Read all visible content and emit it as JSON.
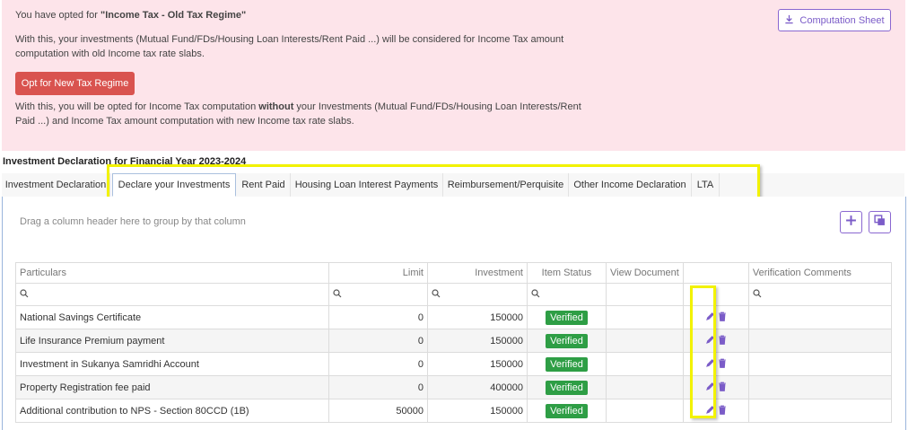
{
  "banner": {
    "line1_prefix": "You have opted for ",
    "line1_bold": "\"Income Tax - Old Tax Regime\"",
    "line2": "With this, your investments (Mutual Fund/FDs/Housing Loan Interests/Rent Paid ...) will be considered for Income Tax amount",
    "line3": "computation with old Income tax rate slabs.",
    "opt_button": "Opt for New Tax Regime",
    "line4_prefix": "With this, you will be opted for Income Tax computation ",
    "line4_bold": "without",
    "line4_suffix": " your Investments (Mutual Fund/FDs/Housing Loan Interests/Rent",
    "line5": "Paid ...) and Income Tax amount computation with new Income tax rate slabs.",
    "computation_button": "Computation Sheet"
  },
  "section_title": "Investment Declaration for Financial Year 2023-2024",
  "tabs": [
    "Investment Declaration",
    "Declare your Investments",
    "Rent Paid",
    "Housing Loan Interest Payments",
    "Reimbursement/Perquisite",
    "Other Income Declaration",
    "LTA"
  ],
  "active_tab": "Declare your Investments",
  "group_hint": "Drag a column header here to group by that column",
  "grid": {
    "columns": [
      "Particulars",
      "Limit",
      "Investment",
      "Item Status",
      "View Document",
      "",
      "Verification Comments"
    ],
    "rows": [
      {
        "particulars": "National Savings Certificate",
        "limit": "0",
        "investment": "150000",
        "status": "Verified"
      },
      {
        "particulars": "Life Insurance Premium payment",
        "limit": "0",
        "investment": "150000",
        "status": "Verified"
      },
      {
        "particulars": "Investment in Sukanya Samridhi Account",
        "limit": "0",
        "investment": "150000",
        "status": "Verified"
      },
      {
        "particulars": "Property Registration fee paid",
        "limit": "0",
        "investment": "400000",
        "status": "Verified"
      },
      {
        "particulars": "Additional contribution to NPS - Section 80CCD (1B)",
        "limit": "50000",
        "investment": "150000",
        "status": "Verified"
      }
    ]
  },
  "icons": {
    "download": "download-icon",
    "add": "plus-icon",
    "copy": "copy-icon",
    "search": "search-icon",
    "edit": "pencil-icon",
    "delete": "trash-icon"
  },
  "colors": {
    "banner_bg": "#fde4ea",
    "danger": "#d9534f",
    "accent": "#7b5cc8",
    "verified": "#2e9e45",
    "highlight": "#f2f200"
  }
}
